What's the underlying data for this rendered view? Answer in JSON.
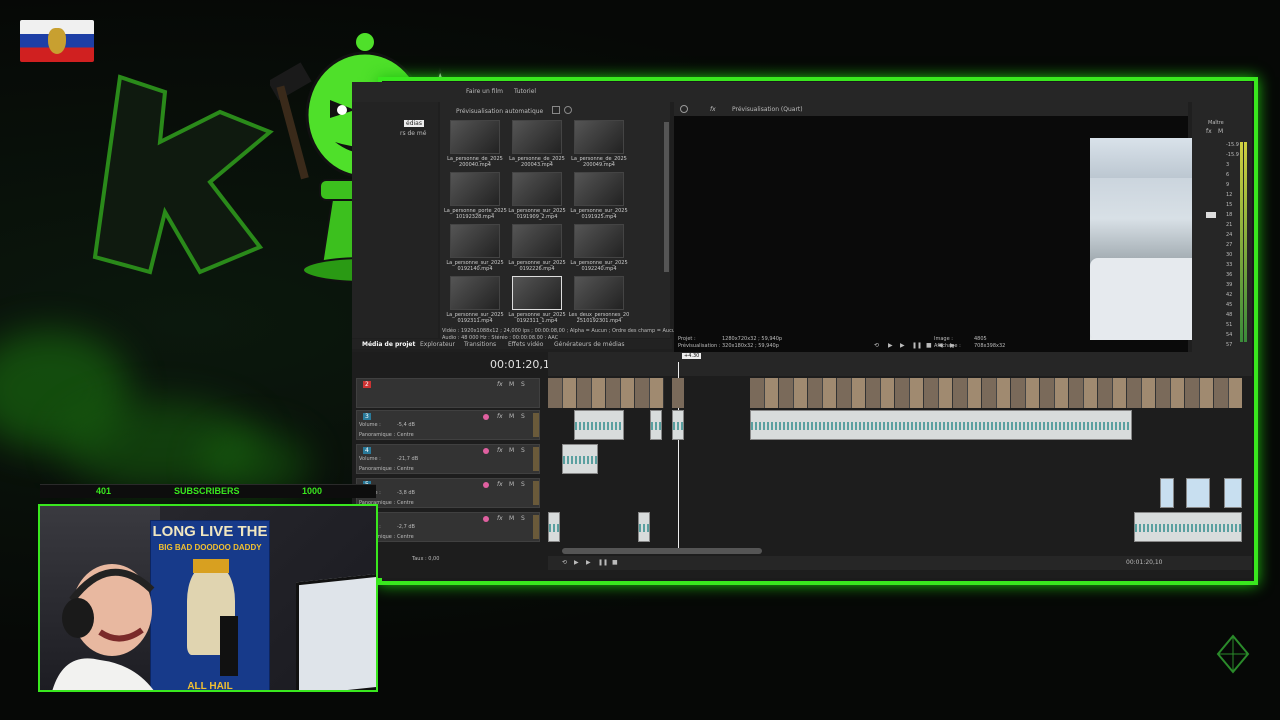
{
  "subscribers": {
    "current": "401",
    "label": "SUBSCRIBERS",
    "goal": "1000"
  },
  "poster": {
    "line1": "LONG LIVE THE",
    "line2": "BIG BAD DOODOO DADDY",
    "line3": "ALL HAIL"
  },
  "editor": {
    "toolbar": {
      "make_movie": "Faire un film",
      "tutorial": "Tutoriel"
    },
    "media_pane": {
      "auto_preview": "Prévisualisation automatique",
      "tab_text": "édias",
      "sub_tab": "rs de mé"
    },
    "media_items": [
      {
        "name": "La_personne_de_2025\n200040.mp4"
      },
      {
        "name": "La_personne_de_2025\n200043.mp4"
      },
      {
        "name": "La_personne_de_2025\n200049.mp4"
      },
      {
        "name": "La_personne_porte_2025\n10192328.mp4"
      },
      {
        "name": "La_personne_sur_2025\n0191909_2.mp4"
      },
      {
        "name": "La_personne_sur_2025\n0191925.mp4"
      },
      {
        "name": "La_personne_sur_2025\n0192140.mp4"
      },
      {
        "name": "La_personne_sur_2025\n0192226.mp4"
      },
      {
        "name": "La_personne_sur_2025\n0192240.mp4"
      },
      {
        "name": "La_personne_sur_2025\n0192311.mp4"
      },
      {
        "name": "La_personne_sur_2025\n0192311_1.mp4"
      },
      {
        "name": "Les_deux_personnes_20\n2510192301.mp4"
      }
    ],
    "media_info": {
      "video": "Vidéo : 1920x1088x12 ; 24,000 ips ; 00:00:08,00 ; Alpha = Aucun ; Ordre des champ = Aucun (analyse",
      "audio": "Audio : 48 000 Hz ; Stéréo ; 00:00:08,00 ; AAC"
    },
    "tabs": [
      "Média de projet",
      "Explorateur",
      "Transitions",
      "Effets vidéo",
      "Générateurs de médias"
    ],
    "preview": {
      "label": "Prévisualisation (Quart)"
    },
    "preview_info": {
      "project_label": "Projet :",
      "project_value": "1280x720x32 ; 59,940p",
      "preview_label": "Prévisualisation :",
      "preview_value": "320x180x32 ; 59,940p",
      "image_label": "Image :",
      "image_value": "4805",
      "display_label": "Affichage :",
      "display_value": "708x398x32"
    },
    "mixer": {
      "title": "Maître",
      "fx": "M",
      "scale": [
        "-15.9",
        "-15.9",
        "3",
        "6",
        "9",
        "12",
        "15",
        "18",
        "21",
        "24",
        "27",
        "30",
        "33",
        "36",
        "39",
        "42",
        "45",
        "48",
        "51",
        "54",
        "57"
      ]
    },
    "timecode": "00:01:20,10",
    "marker": "+4.30",
    "tracks": [
      {
        "num": "2",
        "type": "video"
      },
      {
        "num": "3",
        "volume_label": "Volume :",
        "volume": "-5,4 dB",
        "pan_label": "Panoramique :",
        "pan": "Centre"
      },
      {
        "num": "4",
        "volume_label": "Volume :",
        "volume": "-21,7 dB",
        "pan_label": "Panoramique :",
        "pan": "Centre"
      },
      {
        "num": "5",
        "volume_label": "Volume :",
        "volume": "-3,8 dB",
        "pan_label": "Panoramique :",
        "pan": "Centre"
      },
      {
        "num": "6",
        "volume_label": "Volume :",
        "volume": "-2,7 dB",
        "pan_label": "Panoramique :",
        "pan": "Centre"
      }
    ],
    "bottom_timecode": "00:01:20,10",
    "taux": "Taux : 0,00"
  },
  "colors": {
    "accent": "#39e81e",
    "bg": "#070907",
    "ui": "#1f1f1f"
  }
}
